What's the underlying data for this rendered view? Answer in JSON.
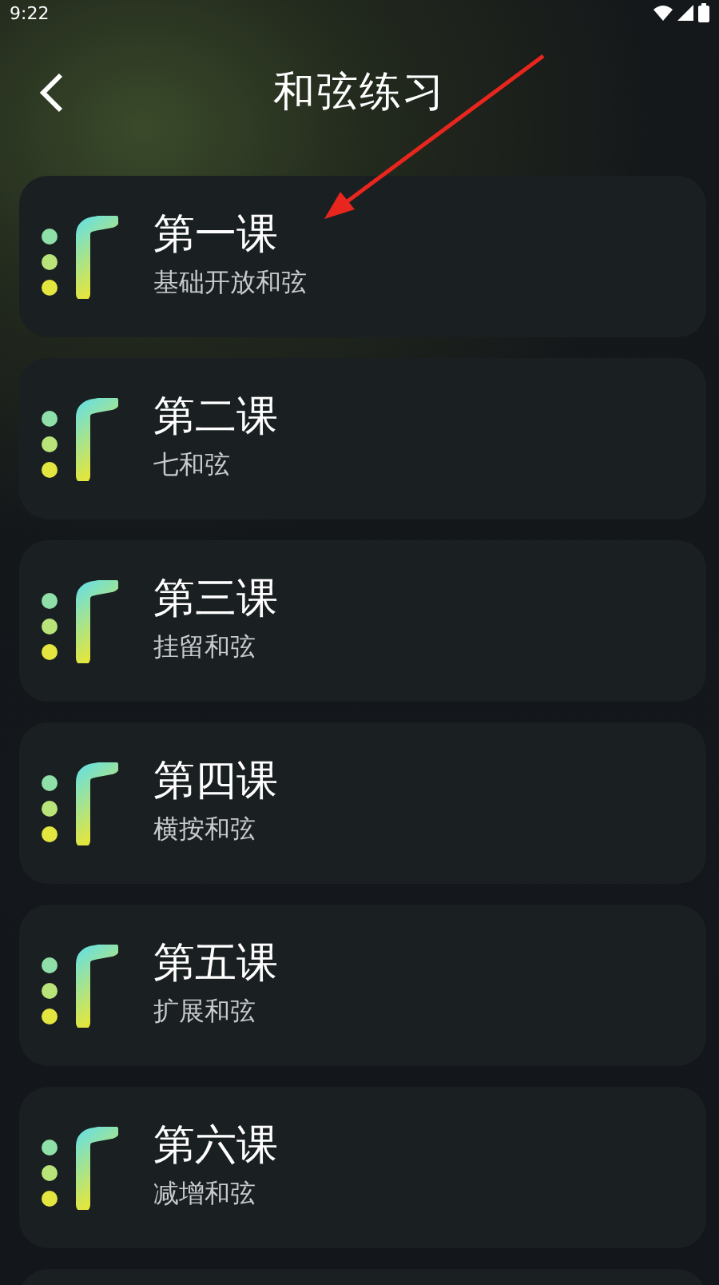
{
  "status_bar": {
    "time": "9:22"
  },
  "header": {
    "title": "和弦练习"
  },
  "lessons": [
    {
      "title": "第一课",
      "subtitle": "基础开放和弦"
    },
    {
      "title": "第二课",
      "subtitle": "七和弦"
    },
    {
      "title": "第三课",
      "subtitle": "挂留和弦"
    },
    {
      "title": "第四课",
      "subtitle": "横按和弦"
    },
    {
      "title": "第五课",
      "subtitle": "扩展和弦"
    },
    {
      "title": "第六课",
      "subtitle": "减增和弦"
    }
  ]
}
